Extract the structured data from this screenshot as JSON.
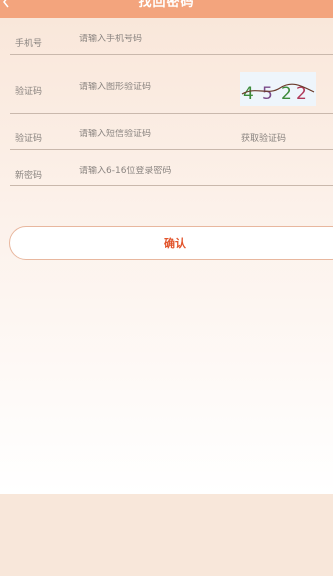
{
  "header": {
    "title": "找回密码"
  },
  "form": {
    "phone": {
      "label": "手机号",
      "placeholder": "请输入手机号码"
    },
    "image_code": {
      "label": "验证码",
      "placeholder": "请输入图形验证码",
      "captcha_text": "4522"
    },
    "sms_code": {
      "label": "验证码",
      "placeholder": "请输入短信验证码",
      "get_code_label": "获取验证码"
    },
    "new_password": {
      "label": "新密码",
      "placeholder": "请输入6-16位登录密码"
    }
  },
  "confirm_label": "确认",
  "colors": {
    "header": "#f3a47d",
    "accent": "#e2542b",
    "background": "#f8e7da"
  }
}
